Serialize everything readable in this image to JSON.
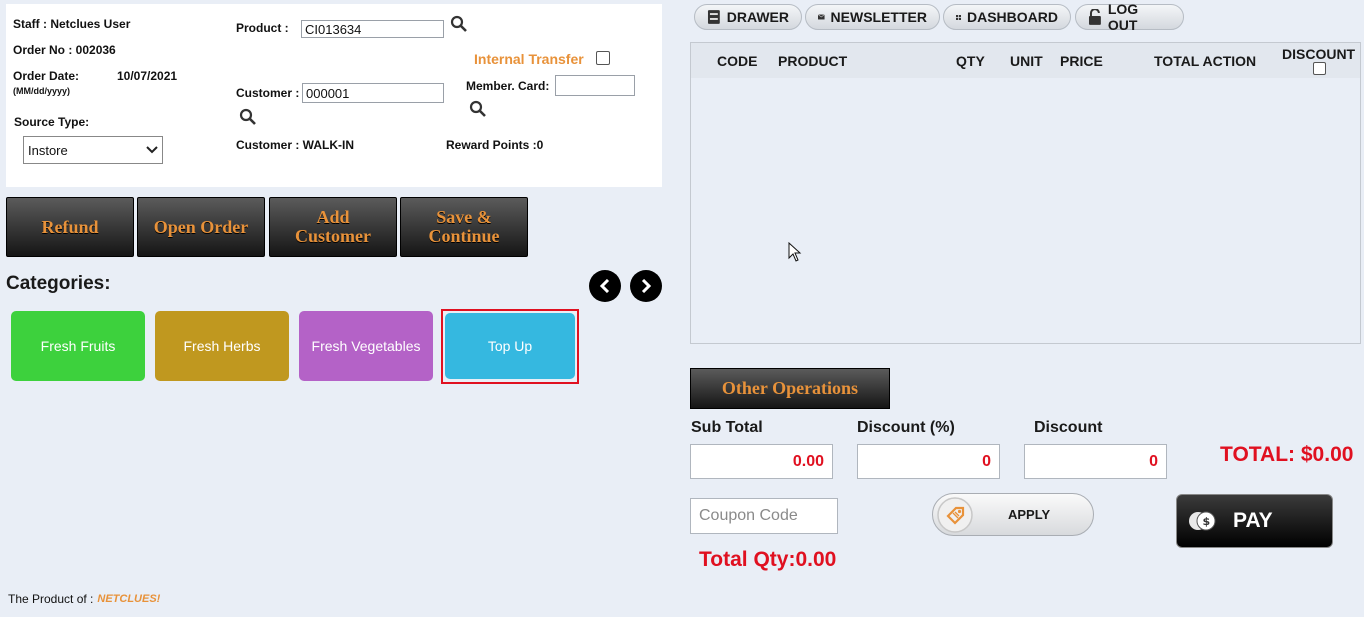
{
  "order_info": {
    "staff": "Staff : Netclues User",
    "order_no": "Order No : 002036",
    "order_date_label": "Order Date:",
    "order_date_format": "(MM/dd/yyyy)",
    "order_date_value": "10/07/2021",
    "source_type_label": "Source Type:",
    "source_type_value": "Instore"
  },
  "product": {
    "label": "Product :",
    "value": "CI013634"
  },
  "internal_transfer_label": "Internal Transfer",
  "customer": {
    "label": "Customer :",
    "value": "000001",
    "name": "Customer : WALK-IN"
  },
  "member_card_label": "Member. Card:",
  "reward_points": "Reward Points :0",
  "actions": {
    "refund": "Refund",
    "open_order": "Open Order",
    "add_customer": "Add Customer",
    "save_continue": "Save & Continue"
  },
  "categories_label": "Categories:",
  "categories": [
    {
      "label": "Fresh Fruits",
      "color": "#3dd13d"
    },
    {
      "label": "Fresh Herbs",
      "color": "#c0981f"
    },
    {
      "label": "Fresh Vegetables",
      "color": "#b462c7"
    },
    {
      "label": "Top Up",
      "color": "#35b8e0"
    }
  ],
  "topnav": {
    "drawer": "DRAWER",
    "newsletter": "NEWSLETTER",
    "dashboard": "DASHBOARD",
    "logout": "LOG OUT"
  },
  "table_headers": {
    "code": "CODE",
    "product": "PRODUCT",
    "qty": "QTY",
    "unit": "UNIT",
    "price": "PRICE",
    "total_action": "TOTAL ACTION",
    "discount": "DISCOUNT"
  },
  "other_operations": "Other Operations",
  "totals": {
    "sub_total_label": "Sub Total",
    "sub_total_value": "0.00",
    "discount_pct_label": "Discount (%)",
    "discount_pct_value": "0",
    "discount_label": "Discount",
    "discount_value": "0",
    "total": "TOTAL: $0.00",
    "total_qty": "Total Qty:0.00"
  },
  "coupon_placeholder": "Coupon Code",
  "apply_label": "APPLY",
  "pay_label": "PAY",
  "footer": {
    "text": "The Product of :",
    "brand": "NETCLUES!"
  },
  "colors": {
    "accent_orange": "#e8923a",
    "total_red": "#e01020",
    "selection_red": "#e01020"
  }
}
